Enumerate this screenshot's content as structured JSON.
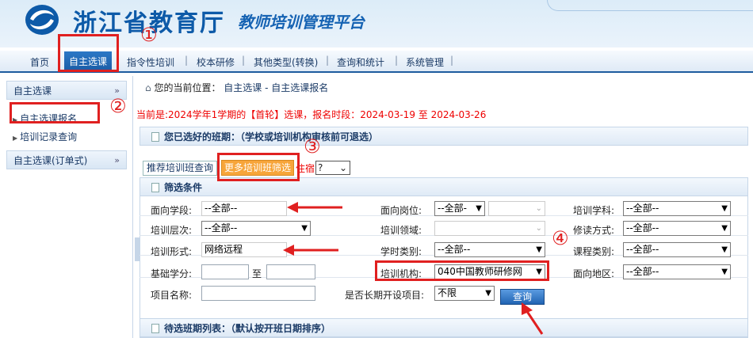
{
  "header": {
    "title": "浙江省教育厅",
    "subtitle": "教师培训管理平台"
  },
  "nav": {
    "items": [
      "首页",
      "自主选课",
      "指令性培训",
      "校本研修",
      "其他类型(转换)",
      "查询和统计",
      "系统管理"
    ],
    "active": "自主选课"
  },
  "sidebar": {
    "section1": "自主选课",
    "section1_chevron": "»",
    "links": [
      "自主选课报名",
      "培训记录查询"
    ],
    "section2": "自主选课(订单式)",
    "section2_chevron": "»"
  },
  "breadcrumb": {
    "prefix": "您的当前位置：",
    "path": "自主选课 - 自主选课报名"
  },
  "notice": "当前是:2024学年1学期的【首轮】选课，报名时段：2024-03-19 至 2024-03-26",
  "selected_header": "您已选好的班期：（学校或培训机构审核前可退选）",
  "tabs": {
    "recommend": "推荐培训班查询",
    "more": "更多培训班筛选",
    "extra_label": "住宿",
    "extra_value": "?"
  },
  "filter": {
    "header": "筛选条件",
    "rows": [
      [
        {
          "label": "面向学段:",
          "value": "--全部--"
        },
        {
          "label": "面向岗位:",
          "value": "--全部-"
        },
        {
          "label": "培训学科:",
          "value": "--全部--"
        }
      ],
      [
        {
          "label": "培训层次:",
          "value": "--全部--"
        },
        {
          "label": "培训领域:",
          "value": ""
        },
        {
          "label": "修读方式:",
          "value": "--全部--"
        }
      ],
      [
        {
          "label": "培训形式:",
          "value": "网络远程"
        },
        {
          "label": "学时类别:",
          "value": "--全部--"
        },
        {
          "label": "课程类别:",
          "value": "--全部--"
        }
      ],
      [
        {
          "label": "基础学分:",
          "value": ""
        },
        {
          "label": "培训机构:",
          "value": "040中国教师研修网"
        },
        {
          "label": "面向地区:",
          "value": "--全部--"
        }
      ]
    ],
    "range_sep": "至",
    "project_name_label": "项目名称:",
    "long_term_label": "是否长期开设项目:",
    "long_term_value": "不限",
    "query_button": "查询"
  },
  "pending_header": "待选班期列表：（默认按开班日期排序）",
  "annotations": [
    "①",
    "②",
    "③",
    "④"
  ],
  "colors": {
    "accent": "#1a5aa3",
    "highlight": "#e02020",
    "tab_orange": "#f7a53a",
    "notice": "#ee0000"
  }
}
